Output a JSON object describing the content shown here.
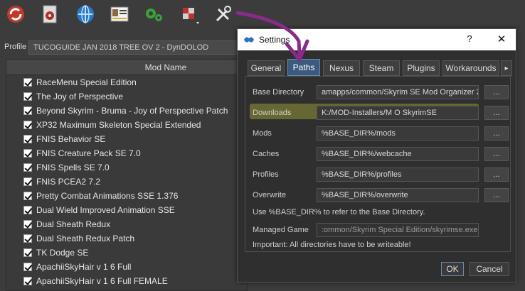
{
  "toolbar": {
    "buttons": [
      {
        "name": "change-game-icon"
      },
      {
        "name": "install-mod-icon"
      },
      {
        "name": "nexus-icon"
      },
      {
        "name": "profiles-icon"
      },
      {
        "name": "executables-icon"
      },
      {
        "name": "tools-icon"
      },
      {
        "name": "settings-icon"
      }
    ]
  },
  "profile": {
    "label": "Profile",
    "value": "TUCOGUIDE JAN 2018 TREE OV 2 - DynDOLOD"
  },
  "modlist": {
    "header": "Mod Name",
    "mods": [
      "RaceMenu Special Edition",
      "The Joy of Perspective",
      "Beyond Skyrim - Bruma - Joy of Perspective Patch",
      "XP32 Maximum Skeleton Special Extended",
      "FNIS Behavior SE",
      "FNIS Creature Pack SE 7.0",
      "FNIS Spells SE 7.0",
      "FNIS PCEA2 7.2",
      "Pretty Combat Animations SSE 1.376",
      "Dual Wield Improved Animation SSE",
      "Dual Sheath Redux",
      "Dual Sheath Redux Patch",
      "TK Dodge SE",
      "ApachiiSkyHair v 1 6 Full",
      "ApachiiSkyHair v 1 6 Full FEMALE"
    ]
  },
  "dialog": {
    "title": "Settings",
    "help": "?",
    "close": "✕",
    "tabs": [
      "General",
      "Paths",
      "Nexus",
      "Steam",
      "Plugins",
      "Workarounds"
    ],
    "active_tab": "Paths",
    "tab_scroll": "▸",
    "paths": {
      "base_directory": {
        "label": "Base Directory",
        "value": "amapps/common/Skyrim SE Mod Organizer 2",
        "browse": "..."
      },
      "downloads": {
        "label": "Downloads",
        "value": "K:/MOD-Installers/M O SkyrimSE",
        "browse": "..."
      },
      "mods": {
        "label": "Mods",
        "value": "%BASE_DIR%/mods",
        "browse": "..."
      },
      "caches": {
        "label": "Caches",
        "value": "%BASE_DIR%/webcache",
        "browse": "..."
      },
      "profiles": {
        "label": "Profiles",
        "value": "%BASE_DIR%/profiles",
        "browse": "..."
      },
      "overwrite": {
        "label": "Overwrite",
        "value": "%BASE_DIR%/overwrite",
        "browse": "..."
      }
    },
    "base_dir_note": "Use %BASE_DIR% to refer to the Base Directory.",
    "managed_game": {
      "label": "Managed Game",
      "value": ":ommon/Skyrim Special Edition/skyrimse.exe"
    },
    "important_note": "Important: All directories have to be writeable!",
    "ok": "OK",
    "cancel": "Cancel"
  },
  "colors": {
    "annotation_arrow": "#8a2a8a",
    "downloads_highlight": "#d2d23c",
    "active_tab": "#3b5a7e"
  }
}
